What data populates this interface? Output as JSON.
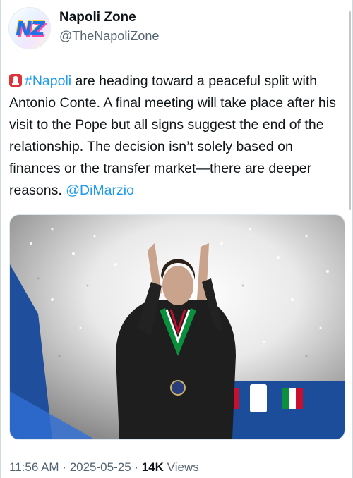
{
  "author": {
    "avatar_text": "NZ",
    "display_name": "Napoli Zone",
    "handle": "@TheNapoliZone"
  },
  "tweet": {
    "emoji": "alert-siren-icon",
    "hashtag": "#Napoli",
    "text_main": " are heading toward a peaceful split with Antonio Conte. A final meeting will take place after his visit to the Pope but all signs suggest the end of the relationship. The decision isn’t solely based on finances or the transfer market—there are deeper reasons. ",
    "mention": "@DiMarzio"
  },
  "media": {
    "type": "photo",
    "subject": "man applauding with medal in front of fireworks"
  },
  "meta": {
    "time": "11:56 AM",
    "separator": " · ",
    "date": "2025-05-25",
    "views_count": "14K",
    "views_label": " Views"
  },
  "colors": {
    "link": "#1d9bf0",
    "secondary_text": "#536471",
    "primary_text": "#0f1419"
  }
}
